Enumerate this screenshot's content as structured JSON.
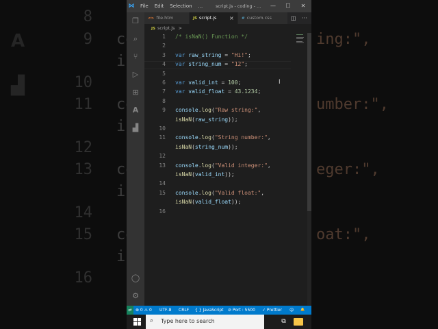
{
  "window": {
    "title": "script.js - coding - ...",
    "menu": [
      "File",
      "Edit",
      "Selection",
      "..."
    ],
    "controls": [
      "—",
      "☐",
      "✕"
    ]
  },
  "tabs": [
    {
      "icon": "<>",
      "label": "file.htm",
      "active": false,
      "icon_color": "#e37933"
    },
    {
      "icon": "JS",
      "label": "script.js",
      "active": true,
      "icon_color": "#cbcb41"
    },
    {
      "icon": "#",
      "label": "custom.css",
      "active": false,
      "icon_color": "#519aba"
    }
  ],
  "tab_close": "×",
  "breadcrumb": {
    "icon": "JS",
    "label": "script.js",
    "sep": ">"
  },
  "code_lines": [
    {
      "n": "1",
      "html": "<span class='c'>/* isNaN() Function */</span>"
    },
    {
      "n": "2",
      "html": ""
    },
    {
      "n": "3",
      "html": "<span class='k'>var</span> <span class='v'>raw_string</span> = <span class='s'>\"Hi!\"</span>;"
    },
    {
      "n": "4",
      "html": "<span class='k'>var</span> <span class='v'>string_num</span> = <span class='s'>\"12\"</span>;"
    },
    {
      "n": "5",
      "html": ""
    },
    {
      "n": "6",
      "html": "<span class='k'>var</span> <span class='v'>valid_int</span> = <span class='n'>100</span>;"
    },
    {
      "n": "7",
      "html": "<span class='k'>var</span> <span class='v'>valid_float</span> = <span class='n'>43.1234</span>;"
    },
    {
      "n": "8",
      "html": ""
    },
    {
      "n": "9",
      "html": "<span class='v'>console</span>.<span class='f'>log</span>(<span class='s'>\"Raw string:\"</span>,",
      "wrap": "<span class='f'>isNaN</span>(<span class='v'>raw_string</span>));"
    },
    {
      "n": "10",
      "html": ""
    },
    {
      "n": "11",
      "html": "<span class='v'>console</span>.<span class='f'>log</span>(<span class='s'>\"String number:\"</span>,",
      "wrap": "<span class='f'>isNaN</span>(<span class='v'>string_num</span>));"
    },
    {
      "n": "12",
      "html": ""
    },
    {
      "n": "13",
      "html": "<span class='v'>console</span>.<span class='f'>log</span>(<span class='s'>\"Valid integer:\"</span>,",
      "wrap": "<span class='f'>isNaN</span>(<span class='v'>valid_int</span>));"
    },
    {
      "n": "14",
      "html": ""
    },
    {
      "n": "15",
      "html": "<span class='v'>console</span>.<span class='f'>log</span>(<span class='s'>\"Valid float:\"</span>,",
      "wrap": "<span class='f'>isNaN</span>(<span class='v'>valid_float</span>));"
    },
    {
      "n": "16",
      "html": ""
    }
  ],
  "status_bar": {
    "remote": "⇄",
    "problems": "⊗ 0 ⚠ 0",
    "encoding": "UTF-8",
    "eol": "CRLF",
    "language": "{ } JavaScript",
    "port": "⊘ Port : 5500",
    "prettier": "✓ Prettier",
    "feedback": "☺",
    "bell": "🔔"
  },
  "taskbar": {
    "search_placeholder": "Type here to search"
  },
  "background": {
    "line_numbers": [
      "8",
      "9",
      "10",
      "11",
      "12",
      "13",
      "14",
      "15",
      "16"
    ],
    "code": [
      "co",
      "is",
      "",
      "co",
      "is",
      "",
      "co",
      "is",
      "",
      "co",
      "is",
      "",
      ""
    ],
    "right_fragments": [
      "ing:\",",
      "umber:\",",
      "eger:\",",
      "oat:\","
    ]
  },
  "colors": {
    "accent": "#007acc",
    "activity_bar": "#333333",
    "editor_bg": "#1e1e1e"
  }
}
